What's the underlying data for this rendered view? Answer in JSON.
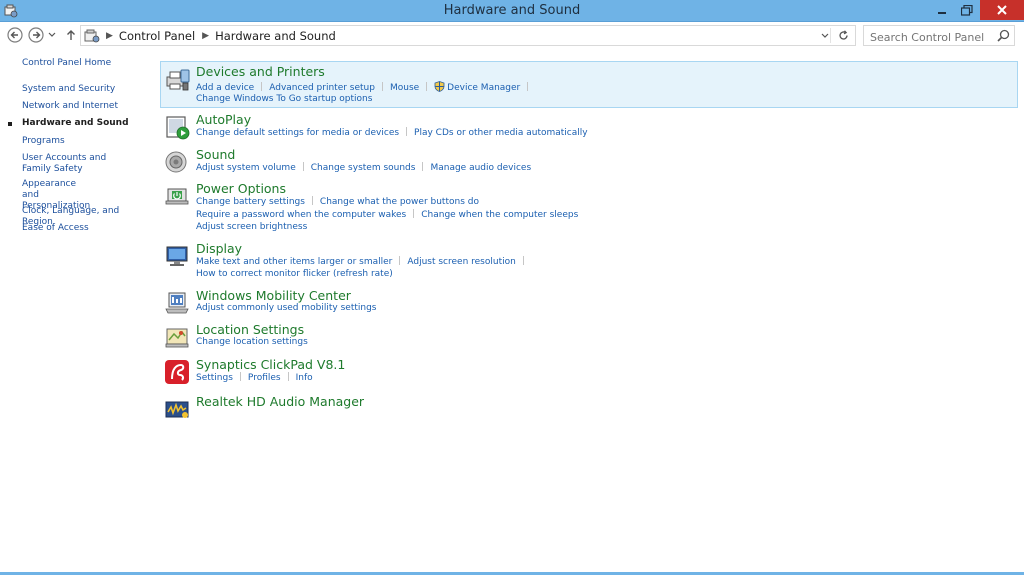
{
  "window": {
    "title": "Hardware and Sound"
  },
  "nav": {
    "breadcrumbs": [
      "Control Panel",
      "Hardware and Sound"
    ],
    "search_placeholder": "Search Control Panel"
  },
  "sidebar": {
    "home_label": "Control Panel Home",
    "items": [
      {
        "label": "System and Security",
        "current": false
      },
      {
        "label": "Network and Internet",
        "current": false
      },
      {
        "label": "Hardware and Sound",
        "current": true
      },
      {
        "label": "Programs",
        "current": false
      },
      {
        "label": "User Accounts and Family Safety",
        "current": false
      },
      {
        "label": "Appearance and Personalization",
        "current": false
      },
      {
        "label": "Clock, Language, and Region",
        "current": false
      },
      {
        "label": "Ease of Access",
        "current": false
      }
    ]
  },
  "categories": [
    {
      "title": "Devices and Printers",
      "icon": "printer-icon",
      "link_rows": [
        [
          "Add a device",
          "Advanced printer setup",
          "Mouse",
          "Device Manager"
        ],
        [
          "Change Windows To Go startup options"
        ]
      ]
    },
    {
      "title": "AutoPlay",
      "icon": "autoplay-icon",
      "link_rows": [
        [
          "Change default settings for media or devices",
          "Play CDs or other media automatically"
        ]
      ]
    },
    {
      "title": "Sound",
      "icon": "speaker-icon",
      "link_rows": [
        [
          "Adjust system volume",
          "Change system sounds",
          "Manage audio devices"
        ]
      ]
    },
    {
      "title": "Power Options",
      "icon": "power-icon",
      "link_rows": [
        [
          "Change battery settings",
          "Change what the power buttons do"
        ],
        [
          "Require a password when the computer wakes",
          "Change when the computer sleeps"
        ],
        [
          "Adjust screen brightness"
        ]
      ]
    },
    {
      "title": "Display",
      "icon": "monitor-icon",
      "link_rows": [
        [
          "Make text and other items larger or smaller",
          "Adjust screen resolution"
        ],
        [
          "How to correct monitor flicker (refresh rate)"
        ]
      ]
    },
    {
      "title": "Windows Mobility Center",
      "icon": "mobility-center-icon",
      "link_rows": [
        [
          "Adjust commonly used mobility settings"
        ]
      ]
    },
    {
      "title": "Location Settings",
      "icon": "location-icon",
      "link_rows": [
        [
          "Change location settings"
        ]
      ]
    },
    {
      "title": "Synaptics ClickPad V8.1",
      "icon": "synaptics-icon",
      "link_rows": [
        [
          "Settings",
          "Profiles",
          "Info"
        ]
      ]
    },
    {
      "title": "Realtek HD Audio Manager",
      "icon": "realtek-audio-icon",
      "link_rows": []
    }
  ],
  "colors": {
    "titlebar": "#6fb3e6",
    "close_button": "#c7302a",
    "category_title": "#1e7a2c",
    "link": "#1b5fb0",
    "selected_bg": "#e5f3fb"
  }
}
